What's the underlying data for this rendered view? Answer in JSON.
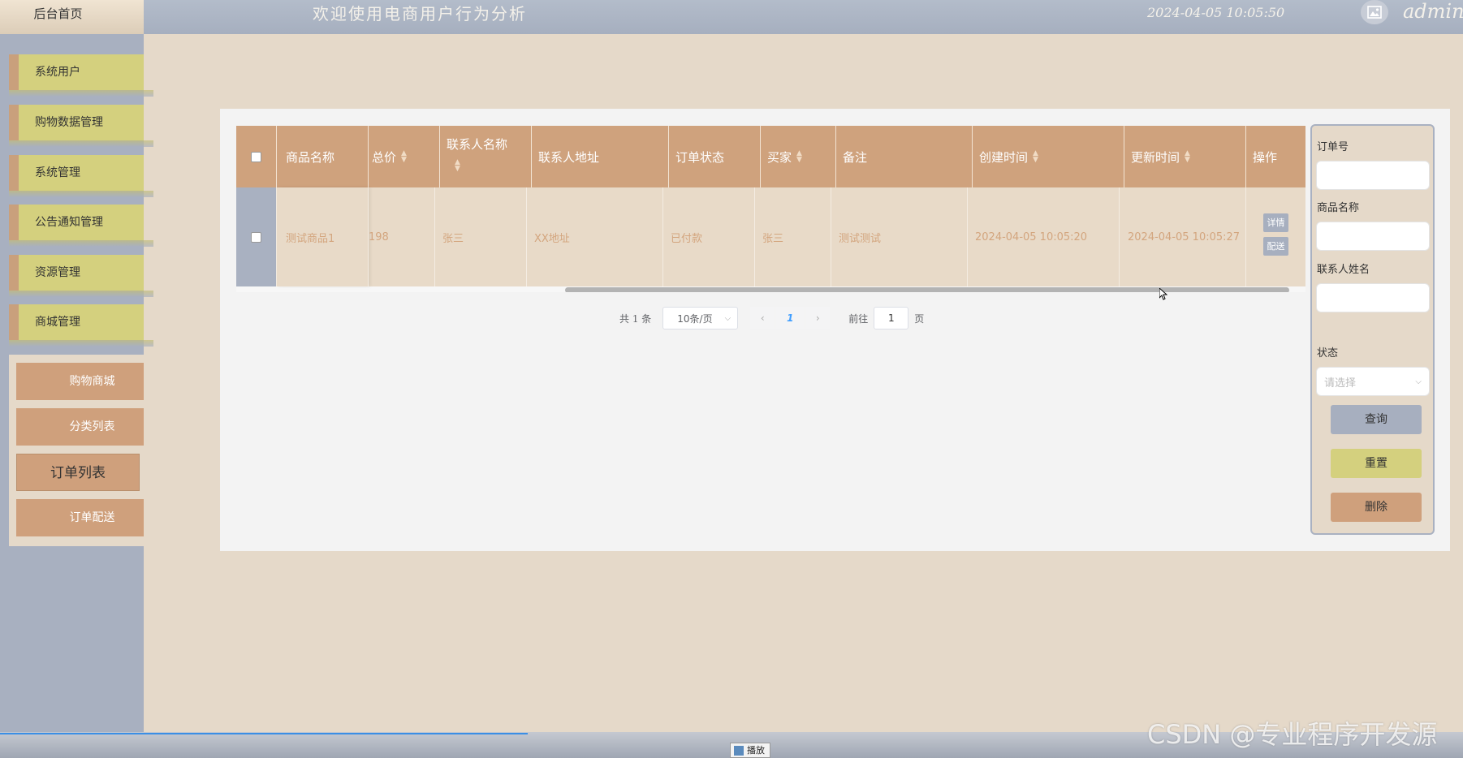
{
  "header": {
    "home_label": "后台首页",
    "title": "欢迎使用电商用户行为分析",
    "datetime": "2024-04-05 10:05:50",
    "username": "admin"
  },
  "sidebar": {
    "items": [
      {
        "label": "系统用户"
      },
      {
        "label": "购物数据管理"
      },
      {
        "label": "系统管理"
      },
      {
        "label": "公告通知管理"
      },
      {
        "label": "资源管理"
      },
      {
        "label": "商城管理"
      }
    ],
    "submenu": [
      {
        "label": "购物商城"
      },
      {
        "label": "分类列表"
      },
      {
        "label": "订单列表",
        "active": true
      },
      {
        "label": "订单配送"
      }
    ]
  },
  "table": {
    "columns": [
      "商品名称",
      "总价",
      "联系人名称",
      "联系人地址",
      "订单状态",
      "买家",
      "备注",
      "创建时间",
      "更新时间",
      "操作"
    ],
    "rows": [
      {
        "product_name": "测试商品1",
        "total": "198",
        "contact_name": "张三",
        "contact_address": "XX地址",
        "status": "已付款",
        "buyer": "张三",
        "remark": "测试测试",
        "created": "2024-04-05 10:05:20",
        "updated": "2024-04-05 10:05:27",
        "actions": [
          "详情",
          "配送"
        ]
      }
    ]
  },
  "pagination": {
    "total_text": "共 1 条",
    "page_size": "10条/页",
    "current_page": "1",
    "goto_prefix": "前往",
    "goto_value": "1",
    "goto_suffix": "页"
  },
  "search": {
    "order_no_label": "订单号",
    "product_name_label": "商品名称",
    "contact_name_label": "联系人姓名",
    "status_label": "状态",
    "status_placeholder": "请选择",
    "query_button": "查询",
    "reset_button": "重置",
    "delete_button": "删除"
  },
  "footer": {
    "play_label": "播放",
    "watermark": "CSDN @专业程序开发源"
  },
  "colors": {
    "header_bg": "#a8b0c0",
    "content_bg": "#e5d9c9",
    "table_header": "#cfa27d",
    "menu_item": "#d4d07e",
    "query_button": "#a7afbf",
    "reset_button": "#d4d07e",
    "delete_button": "#cfa07c"
  }
}
